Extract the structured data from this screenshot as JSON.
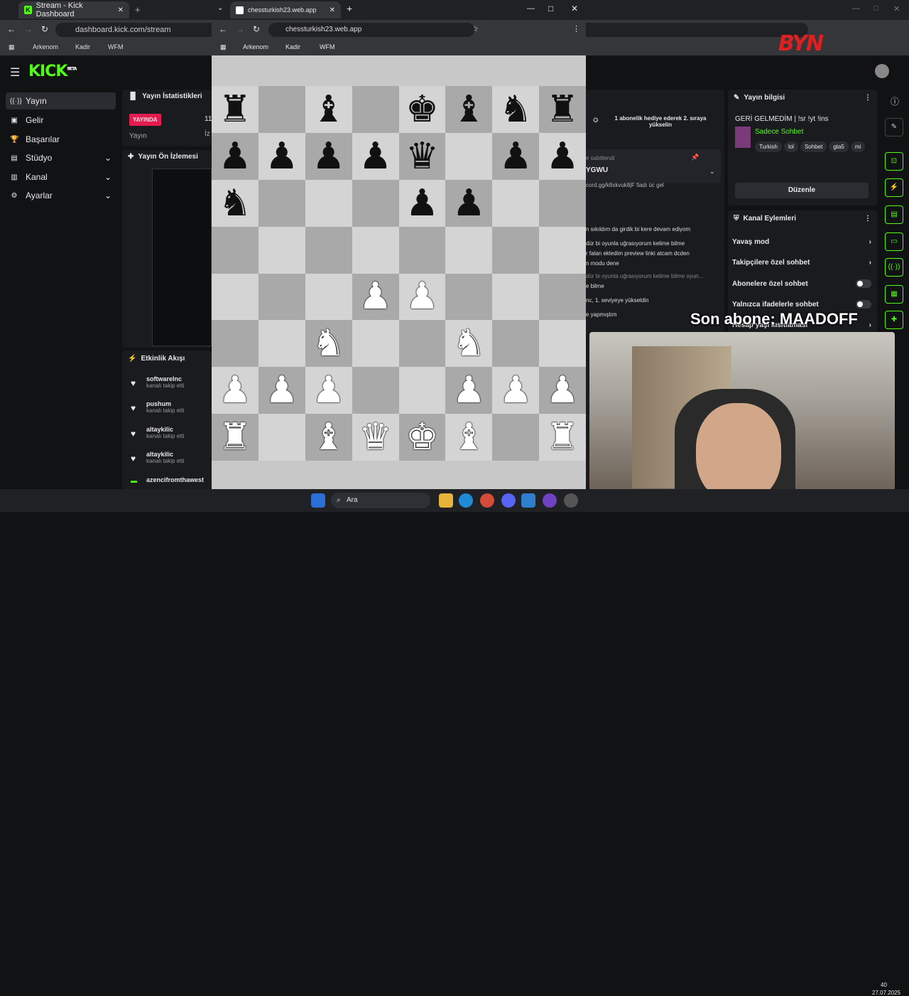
{
  "main_browser": {
    "tab_title": "Stream - Kick Dashboard",
    "url": "dashboard.kick.com/stream",
    "bookmarks": [
      "Arkenom",
      "Kadir",
      "WFM"
    ]
  },
  "kick": {
    "logo": "KICK",
    "logo_badge": "BETA",
    "sidebar": [
      {
        "label": "Yayın",
        "icon": "broadcast-icon"
      },
      {
        "label": "Gelir",
        "icon": "money-icon"
      },
      {
        "label": "Başarılar",
        "icon": "trophy-icon"
      },
      {
        "label": "Stüdyo",
        "icon": "studio-icon"
      },
      {
        "label": "Kanal",
        "icon": "channel-icon"
      },
      {
        "label": "Ayarlar",
        "icon": "gear-icon"
      }
    ],
    "stats_title": "Yayın İstatistikleri",
    "live_badge": "YAYINDA",
    "stats_label": "Yayın",
    "stats_value": "11",
    "stats_label2": "İz",
    "preview_title": "Yayın Ön İzlemesi",
    "activity_title": "Etkinlik Akışı",
    "activity": [
      {
        "user": "softwareInc",
        "action": "kanalı takip etti"
      },
      {
        "user": "pushum",
        "action": "kanalı takip etti"
      },
      {
        "user": "altaykilic",
        "action": "kanalı takip etti"
      },
      {
        "user": "altaykilic",
        "action": "kanalı takip etti"
      },
      {
        "user": "azencifromthawest",
        "action": ""
      }
    ],
    "chat": {
      "gift": "1 abonelik hediye ederek 2. sıraya yükselin",
      "pinned": "e sabitlendi",
      "pinned_text": "YGWU",
      "lines": [
        "cord.gg/k8xkvuk8jF fiadı üc gel",
        "n sıkıldım da girdik bi kere devam ediyom",
        "dür bi oyunla uğrasıyorum kelime bilme",
        "r falan ekledim preview linki atcam dcden",
        "n modu dene",
        "dür bi oyunla uğrasıyorum kelime bilme oyun...",
        "e bilme",
        "nc, 1. seviyeye yükseldin",
        "e yapmıştım"
      ]
    },
    "info": {
      "title": "Yayın bilgisi",
      "stream_title": "GERİ GELMEDİM | !sr !yt !ins",
      "category": "Sadece Sohbet",
      "tags": [
        "Turkish",
        "lol",
        "Sohbet",
        "gta5",
        "mi"
      ],
      "edit_button": "Düzenle"
    },
    "actions": {
      "title": "Kanal Eylemleri",
      "items": [
        {
          "label": "Yavaş mod",
          "type": "arrow"
        },
        {
          "label": "Takipçilere özel sohbet",
          "type": "arrow"
        },
        {
          "label": "Abonelere özel sohbet",
          "type": "toggle"
        },
        {
          "label": "Yalnızca ifadelerle sohbet",
          "type": "toggle"
        },
        {
          "label": "Hesap yaşı kısıtlaması",
          "type": "arrow"
        }
      ]
    }
  },
  "chess_browser": {
    "tab_title": "chessturkish23.web.app",
    "url": "chessturkish23.web.app",
    "bookmarks": [
      "Arkenom",
      "Kadir",
      "WFM"
    ],
    "board": [
      [
        "br",
        "",
        "bb",
        "",
        "bk",
        "bb",
        "bn",
        "br"
      ],
      [
        "bp",
        "bp",
        "bp",
        "bp",
        "bq",
        "",
        "bp",
        "bp"
      ],
      [
        "bn",
        "",
        "",
        "",
        "bp",
        "bp",
        "",
        ""
      ],
      [
        "",
        "",
        "",
        "",
        "",
        "",
        "",
        ""
      ],
      [
        "",
        "",
        "",
        "wp",
        "wp",
        "",
        "",
        ""
      ],
      [
        "",
        "",
        "wn",
        "",
        "",
        "wn",
        "",
        ""
      ],
      [
        "wp",
        "wp",
        "wp",
        "",
        "",
        "wp",
        "wp",
        "wp"
      ],
      [
        "wr",
        "",
        "wb",
        "wq",
        "wk",
        "wb",
        "",
        "wr"
      ]
    ]
  },
  "overlay": {
    "sub_text": "Son abone: MAADOFF",
    "logo_text": "BYN"
  },
  "taskbar": {
    "search": "Ara",
    "time": "40",
    "date": "27.07.2025"
  }
}
